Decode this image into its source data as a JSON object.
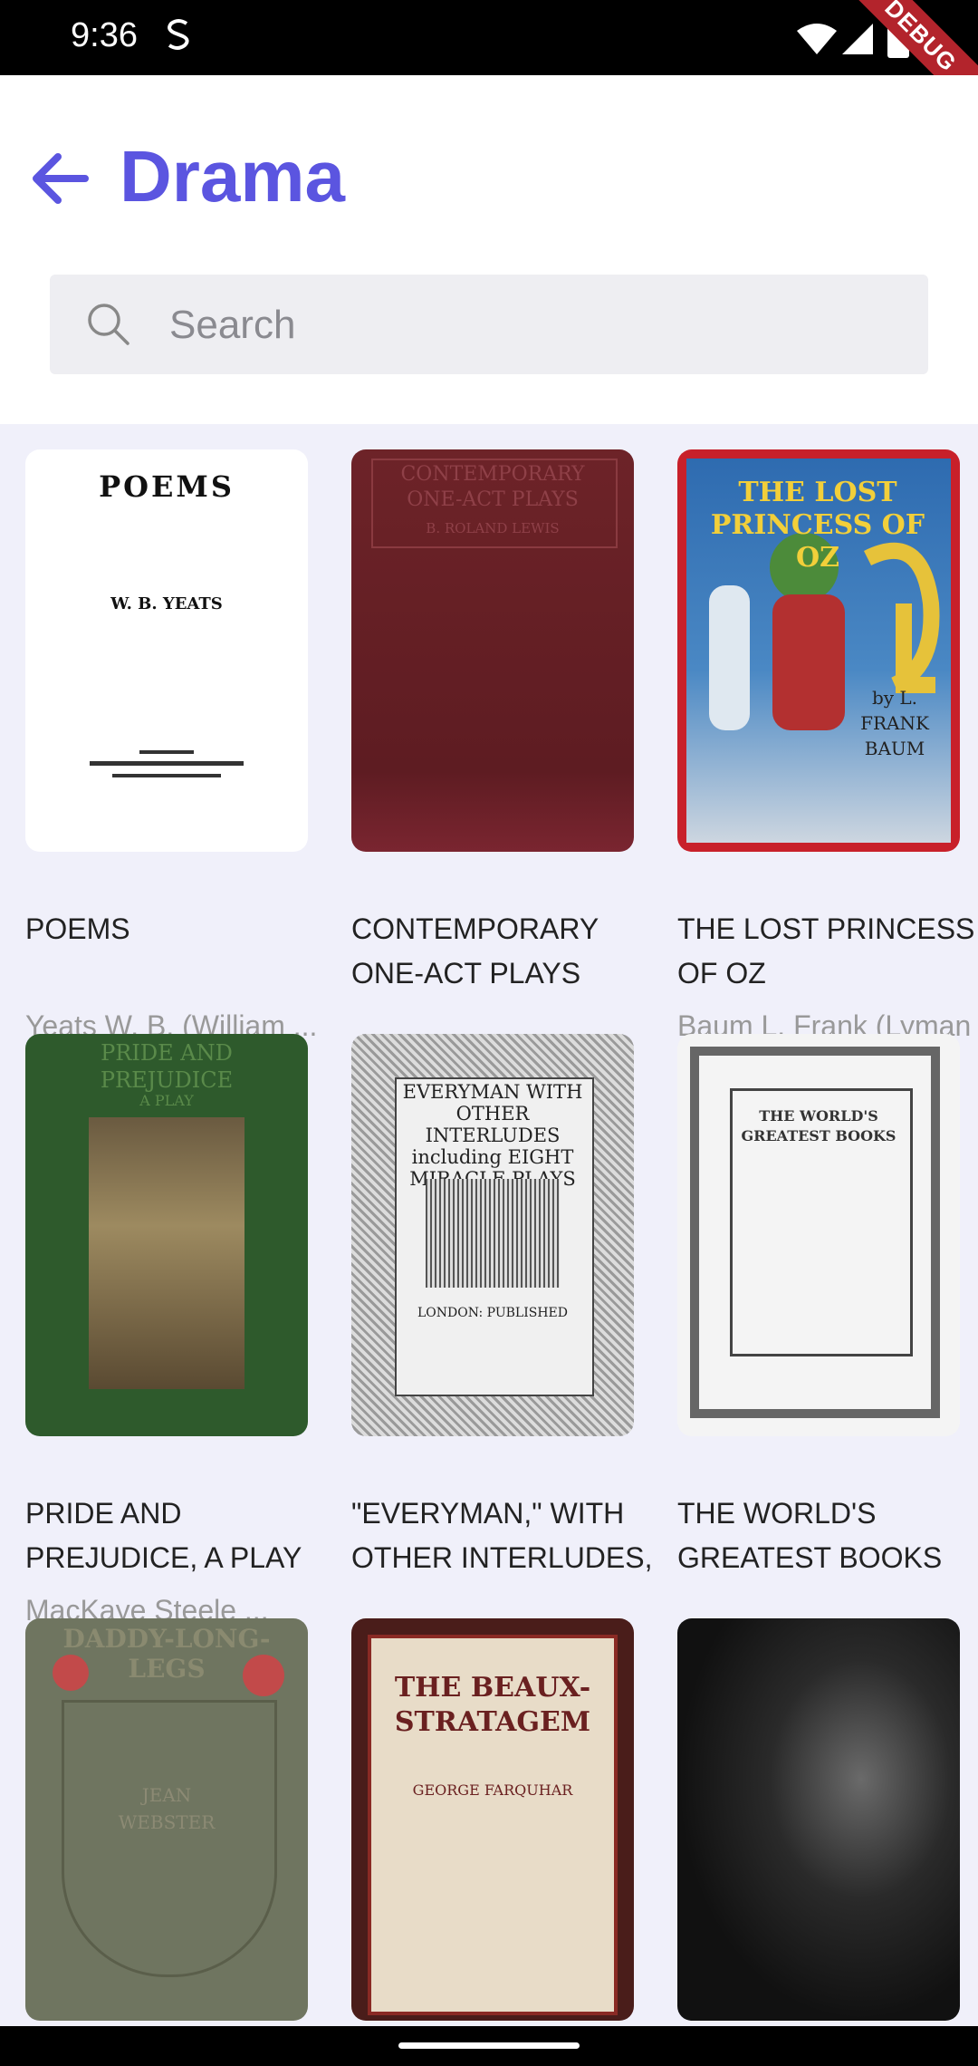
{
  "status": {
    "time": "9:36",
    "sim_glyph": "S",
    "debug": "DEBUG"
  },
  "header": {
    "title": "Drama"
  },
  "search": {
    "placeholder": "Search"
  },
  "books": [
    {
      "title": "POEMS",
      "author": "Yeats W. B. (William ...",
      "cover_text": "POEMS",
      "cover_sub": "W. B. YEATS",
      "cover_color": "#ffffff"
    },
    {
      "title": "CONTEMPORARY ONE-ACT PLAYS",
      "author": "",
      "cover_text": "CONTEMPORARY ONE-ACT PLAYS",
      "cover_sub": "B. ROLAND LEWIS",
      "cover_color": "#6d2328"
    },
    {
      "title": "THE LOST PRINCESS OF OZ",
      "author": "Baum L. Frank (Lyman",
      "cover_text": "THE LOST PRINCESS OF OZ",
      "cover_sub": "by L. FRANK BAUM",
      "cover_color": "#c8202a"
    },
    {
      "title": "PRIDE AND PREJUDICE, A PLAY FOUNDED ON ...",
      "author": "MacKaye Steele ...",
      "cover_text": "PRIDE AND PREJUDICE",
      "cover_sub": "A PLAY",
      "cover_color": "#2e5a2c"
    },
    {
      "title": "\"EVERYMAN,\" WITH OTHER INTERLUDES, ...",
      "author": "",
      "cover_text": "EVERYMAN WITH OTHER INTERLUDES including EIGHT MIRACLE PLAYS",
      "cover_sub": "LONDON: PUBLISHED",
      "cover_color": "#cfcfcf"
    },
    {
      "title": "THE WORLD'S GREATEST BOOKS Â��",
      "author": "",
      "cover_text": "THE WORLD'S GREATEST BOOKS",
      "cover_sub": "",
      "cover_color": "#f4f4f4"
    },
    {
      "title": "",
      "author": "",
      "cover_text": "DADDY-LONG-LEGS",
      "cover_sub": "JEAN WEBSTER",
      "cover_color": "#6f7560"
    },
    {
      "title": "",
      "author": "",
      "cover_text": "THE BEAUX-STRATAGEM",
      "cover_sub": "GEORGE FARQUHAR",
      "cover_color": "#4a1d1a"
    },
    {
      "title": "",
      "author": "",
      "cover_text": "",
      "cover_sub": "",
      "cover_color": "#1a1a1a"
    }
  ]
}
